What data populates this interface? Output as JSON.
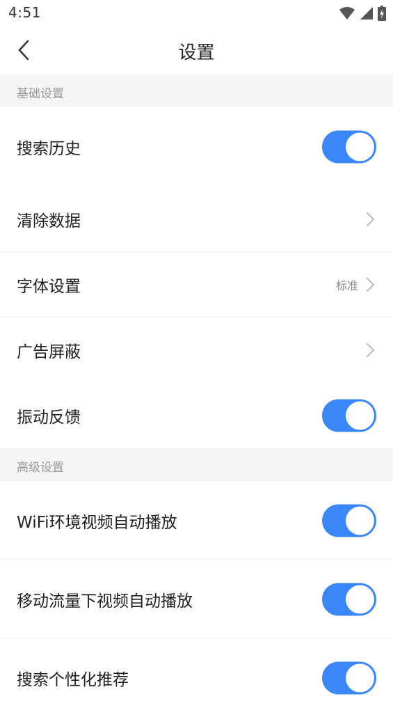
{
  "status_bar": {
    "time": "4:51"
  },
  "app_bar": {
    "title": "设置"
  },
  "sections": {
    "basic": {
      "header": "基础设置",
      "search_history": {
        "label": "搜索历史",
        "enabled": true
      },
      "clear_data": {
        "label": "清除数据"
      },
      "font_settings": {
        "label": "字体设置",
        "value": "标准"
      },
      "ad_block": {
        "label": "广告屏蔽"
      },
      "vibration_feedback": {
        "label": "振动反馈",
        "enabled": true
      }
    },
    "advanced": {
      "header": "高级设置",
      "wifi_autoplay": {
        "label": "WiFi环境视频自动播放",
        "enabled": true
      },
      "mobile_autoplay": {
        "label": "移动流量下视频自动播放",
        "enabled": true
      },
      "personalized_recommend": {
        "label": "搜索个性化推荐",
        "enabled": true
      }
    }
  },
  "colors": {
    "accent": "#3b87f7",
    "section_bg": "#f5f5f5",
    "muted_text": "#999999"
  }
}
